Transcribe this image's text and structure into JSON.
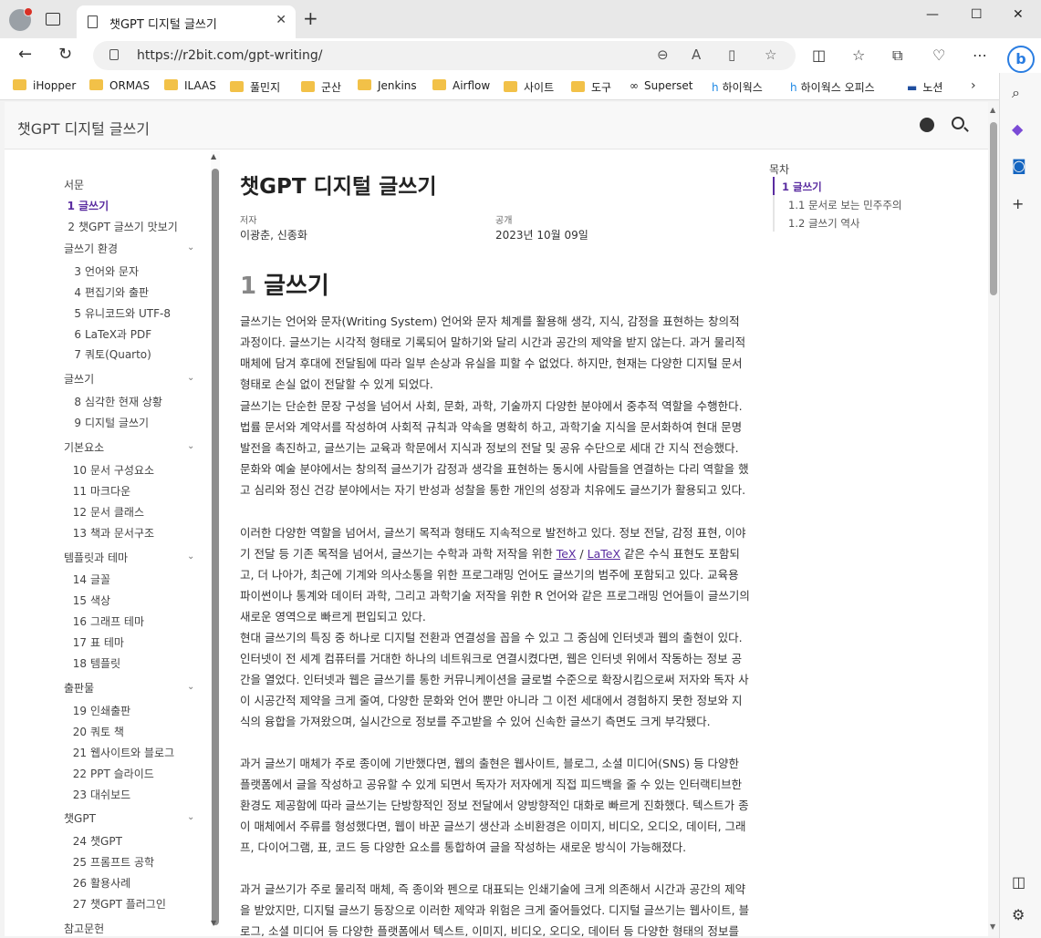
{
  "browser": {
    "tab_title": "챗GPT 디지털 글쓰기",
    "url": "https://r2bit.com/gpt-writing/",
    "bookmarks": [
      "iHopper",
      "ORMAS",
      "ILAAS",
      "풀민지",
      "군산",
      "Jenkins",
      "Airflow",
      "사이트",
      "도구",
      "Superset",
      "하이웍스",
      "하이웍스 오피스",
      "노션"
    ]
  },
  "site": {
    "title": "챗GPT 디지털 글쓰기"
  },
  "sidebar": {
    "intro": "서문",
    "items": [
      {
        "num": "1",
        "label": "글쓰기",
        "active": true
      },
      {
        "num": "2",
        "label": "챗GPT 글쓰기 맛보기"
      }
    ],
    "sections": [
      {
        "title": "글쓰기 환경",
        "items": [
          {
            "num": "3",
            "label": "언어와 문자"
          },
          {
            "num": "4",
            "label": "편집기와 출판"
          },
          {
            "num": "5",
            "label": "유니코드와 UTF-8"
          },
          {
            "num": "6",
            "label": "LaTeX과 PDF"
          },
          {
            "num": "7",
            "label": "쿼토(Quarto)"
          }
        ]
      },
      {
        "title": "글쓰기",
        "items": [
          {
            "num": "8",
            "label": "심각한 현재 상황"
          },
          {
            "num": "9",
            "label": "디지털 글쓰기"
          }
        ]
      },
      {
        "title": "기본요소",
        "items": [
          {
            "num": "10",
            "label": "문서 구성요소"
          },
          {
            "num": "11",
            "label": "마크다운"
          },
          {
            "num": "12",
            "label": "문서 클래스"
          },
          {
            "num": "13",
            "label": "책과 문서구조"
          }
        ]
      },
      {
        "title": "템플릿과 테마",
        "items": [
          {
            "num": "14",
            "label": "글꼴"
          },
          {
            "num": "15",
            "label": "색상"
          },
          {
            "num": "16",
            "label": "그래프 테마"
          },
          {
            "num": "17",
            "label": "표 테마"
          },
          {
            "num": "18",
            "label": "템플릿"
          }
        ]
      },
      {
        "title": "출판물",
        "items": [
          {
            "num": "19",
            "label": "인쇄출판"
          },
          {
            "num": "20",
            "label": "쿼토 책"
          },
          {
            "num": "21",
            "label": "웹사이트와 블로그"
          },
          {
            "num": "22",
            "label": "PPT 슬라이드"
          },
          {
            "num": "23",
            "label": "대쉬보드"
          }
        ]
      },
      {
        "title": "챗GPT",
        "items": [
          {
            "num": "24",
            "label": "챗GPT"
          },
          {
            "num": "25",
            "label": "프롬프트 공학"
          },
          {
            "num": "26",
            "label": "활용사례"
          },
          {
            "num": "27",
            "label": "챗GPT 플러그인"
          }
        ]
      }
    ],
    "references": "참고문헌"
  },
  "doc": {
    "title": "챗GPT 디지털 글쓰기",
    "author_label": "저자",
    "authors": "이광춘, 신종화",
    "date_label": "공개",
    "date": "2023년 10월 09일",
    "h1_num": "1",
    "h1_text": "글쓰기",
    "p1": "글쓰기는 언어와 문자(Writing System) 언어와 문자 체계를 활용해 생각, 지식, 감정을 표현하는 창의적 과정이다. 글쓰기는 시각적 형태로 기록되어 말하기와 달리 시간과 공간의 제약을 받지 않는다. 과거 물리적 매체에 담겨 후대에 전달됨에 따라 일부 손상과 유실을 피할 수 없었다. 하지만, 현재는 다양한 디지털 문서 형태로 손실 없이 전달할 수 있게 되었다.",
    "p2": "글쓰기는 단순한 문장 구성을 넘어서 사회, 문화, 과학, 기술까지 다양한 분야에서 중추적 역할을 수행한다. 법률 문서와 계약서를 작성하여 사회적 규칙과 약속을 명확히 하고, 과학기술 지식을 문서화하여 현대 문명 발전을 촉진하고, 글쓰기는 교육과 학문에서 지식과 정보의 전달 및 공유 수단으로 세대 간 지식 전승했다. 문화와 예술 분야에서는 창의적 글쓰기가 감정과 생각을 표현하는 동시에 사람들을 연결하는 다리 역할을 했고 심리와 정신 건강 분야에서는 자기 반성과 성찰을 통한 개인의 성장과 치유에도 글쓰기가 활용되고 있다.",
    "p3_a": "이러한 다양한 역할을 넘어서, 글쓰기 목적과 형태도 지속적으로 발전하고 있다. 정보 전달, 감정 표현, 이야기 전달 등 기존 목적을 넘어서, 글쓰기는 수학과 과학 저작을 위한 ",
    "p3_link1": "TeX",
    "p3_sep": " / ",
    "p3_link2": "LaTeX",
    "p3_b": " 같은 수식 표현도 포함되고, 더 나아가, 최근에 기계와 의사소통을 위한 프로그래밍 언어도 글쓰기의 범주에 포함되고 있다. 교육용 파이썬이나 통계와 데이터 과학, 그리고 과학기술 저작을 위한 R 언어와 같은 프로그래밍 언어들이 글쓰기의 새로운 영역으로 빠르게 편입되고 있다.",
    "p4": "현대 글쓰기의 특징 중 하나로 디지털 전환과 연결성을 꼽을 수 있고 그 중심에 인터넷과 웹의 출현이 있다. 인터넷이 전 세계 컴퓨터를 거대한 하나의 네트워크로 연결시켰다면, 웹은 인터넷 위에서 작동하는 정보 공간을 열었다. 인터넷과 웹은 글쓰기를 통한 커뮤니케이션을 글로벌 수준으로 확장시킴으로써 저자와 독자 사이 시공간적 제약을 크게 줄여, 다양한 문화와 언어 뿐만 아니라 그 이전 세대에서 경험하지 못한 정보와 지식의 융합을 가져왔으며, 실시간으로 정보를 주고받을 수 있어 신속한 글쓰기 측면도 크게 부각됐다.",
    "p5": "과거 글쓰기 매체가 주로 종이에 기반했다면, 웹의 출현은 웹사이트, 블로그, 소셜 미디어(SNS) 등 다양한 플랫폼에서 글을 작성하고 공유할 수 있게 되면서 독자가 저자에게 직접 피드백을 줄 수 있는 인터랙티브한 환경도 제공함에 따라 글쓰기는 단방향적인 정보 전달에서 양방향적인 대화로 빠르게 진화했다. 텍스트가 종이 매체에서 주류를 형성했다면, 웹이 바꾼 글쓰기 생산과 소비환경은 이미지, 비디오, 오디오, 데이터, 그래프, 다이어그램, 표, 코드 등 다양한 요소를 통합하여 글을 작성하는 새로운 방식이 가능해졌다.",
    "p6": "과거 글쓰기가 주로 물리적 매체, 즉 종이와 펜으로 대표되는 인쇄기술에 크게 의존해서 시간과 공간의 제약을 받았지만, 디지털 글쓰기 등장으로 이러한 제약과 위험은 크게 줄어들었다. 디지털 글쓰기는 웹사이트, 블로그, 소셜 미디어 등 다양한 플랫폼에서 텍스트, 이미지, 비디오, 오디오, 데이터 등 다양한 형태의 정보를 통합적으로 전달할 수 있고, 인터넷을 통해 전 세계 어디서든 접근하고 소전할"
  },
  "toc": {
    "title": "목차",
    "items": [
      {
        "label": "1 글쓰기",
        "active": true
      },
      {
        "label": "1.1 문서로 보는 민주주의"
      },
      {
        "label": "1.2 글쓰기 역사"
      }
    ]
  }
}
